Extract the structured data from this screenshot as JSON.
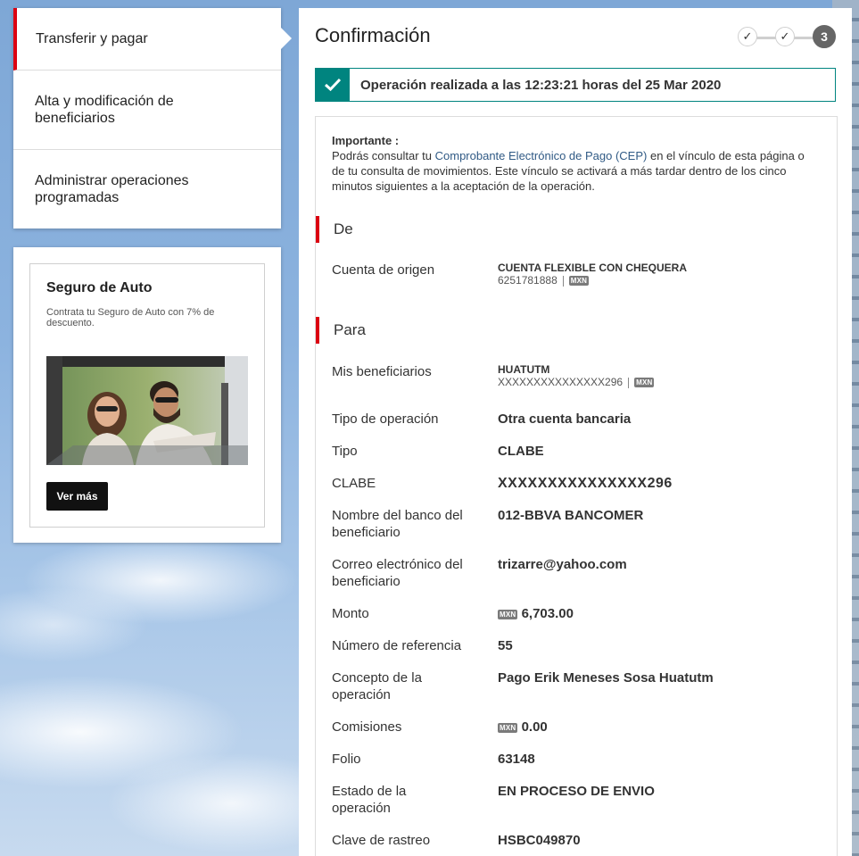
{
  "nav": {
    "items": [
      {
        "label": "Transferir y pagar"
      },
      {
        "label": "Alta y modificación de beneficiarios"
      },
      {
        "label": "Administrar operaciones programadas"
      }
    ]
  },
  "promo": {
    "title": "Seguro de Auto",
    "description": "Contrata tu Seguro de Auto con 7% de descuento.",
    "button_label": "Ver más"
  },
  "main": {
    "title": "Confirmación",
    "steps": [
      "✓",
      "✓",
      "3"
    ],
    "success_message": "Operación realizada a las 12:23:21 horas del 25 Mar 2020",
    "notice": {
      "heading": "Importante :",
      "text_before": "Podrás consultar tu ",
      "link": "Comprobante Electrónico de Pago (CEP)",
      "text_after": " en el vínculo de esta página o de tu consulta de movimientos. Este vínculo se activará a más tardar dentro de los cinco minutos siguientes a la aceptación de la operación."
    },
    "de": {
      "heading": "De",
      "origin_label": "Cuenta de origen",
      "origin_name": "CUENTA FLEXIBLE CON CHEQUERA",
      "origin_number": "6251781888",
      "origin_currency": "MXN"
    },
    "para": {
      "heading": "Para",
      "beneficiary_label": "Mis beneficiarios",
      "beneficiary_name": "HUATUTM",
      "beneficiary_account": "XXXXXXXXXXXXXXX296",
      "beneficiary_currency": "MXN",
      "rows": [
        {
          "label": "Tipo de operación",
          "value": "Otra cuenta bancaria"
        },
        {
          "label": "Tipo",
          "value": "CLABE"
        },
        {
          "label": "CLABE",
          "value": "XXXXXXXXXXXXXXX296"
        },
        {
          "label": "Nombre del banco del beneficiario",
          "value": "012-BBVA BANCOMER"
        },
        {
          "label": "Correo electrónico del beneficiario",
          "value": "trizarre@yahoo.com"
        },
        {
          "label": "Monto",
          "value": "6,703.00",
          "currency": "MXN"
        },
        {
          "label": "Número de referencia",
          "value": "55"
        },
        {
          "label": "Concepto de la operación",
          "value": "Pago Erik Meneses Sosa Huatutm"
        },
        {
          "label": "Comisiones",
          "value": "0.00",
          "currency": "MXN"
        },
        {
          "label": "Folio",
          "value": "63148"
        },
        {
          "label": "Estado de la operación",
          "value": "EN PROCESO DE ENVIO"
        },
        {
          "label": "Clave de rastreo",
          "value": "HSBC049870"
        }
      ]
    }
  },
  "colors": {
    "accent_red": "#db0011",
    "success_teal": "#00847f",
    "link_blue": "#305a85"
  }
}
